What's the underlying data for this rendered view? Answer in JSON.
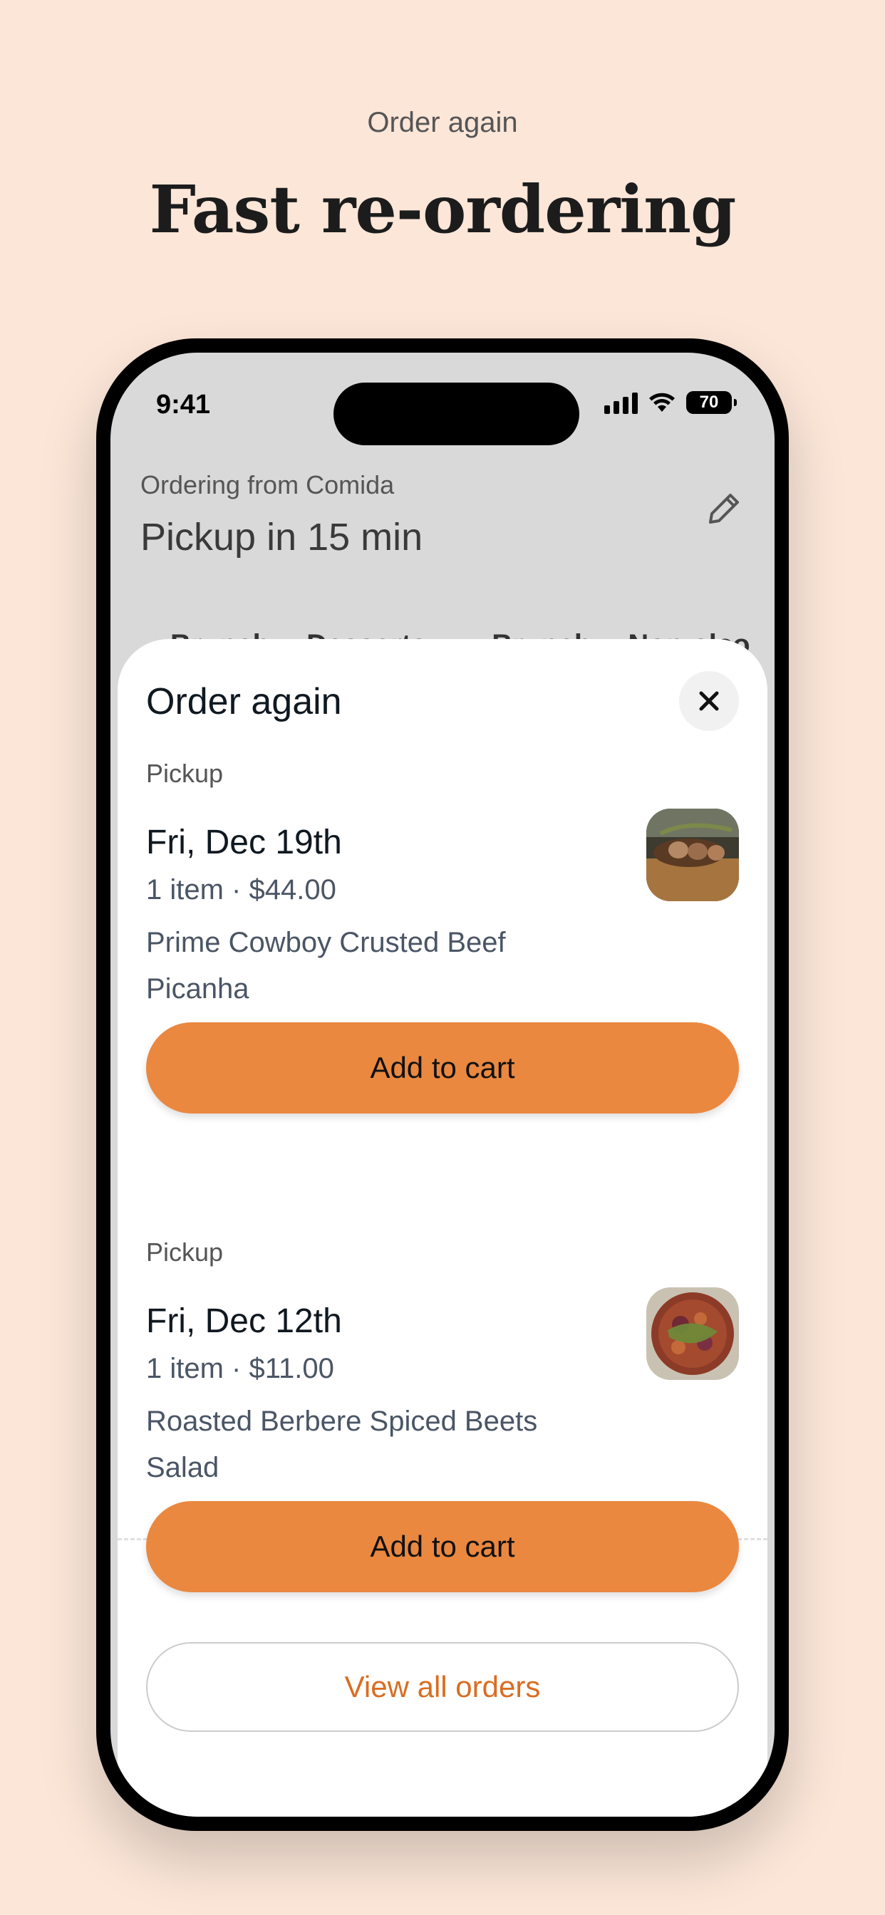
{
  "promo": {
    "eyebrow": "Order again",
    "headline": "Fast re-ordering"
  },
  "status_bar": {
    "time": "9:41",
    "battery": "70"
  },
  "header": {
    "ordering_from": "Ordering from Comida",
    "pickup_time": "Pickup in 15 min",
    "edit_icon": "pencil-icon"
  },
  "categories": [
    "Brunch",
    "Desserts",
    "",
    "Brunch",
    "Non-alco"
  ],
  "sheet": {
    "title": "Order again",
    "close_icon": "close-icon",
    "orders": [
      {
        "type": "Pickup",
        "date": "Fri, Dec 19th",
        "summary": "1 item · $44.00",
        "item": "Prime Cowboy Crusted Beef Picanha",
        "button": "Add to cart"
      },
      {
        "type": "Pickup",
        "date": "Fri, Dec 12th",
        "summary": "1 item · $11.00",
        "item": "Roasted Berbere Spiced Beets Salad",
        "button": "Add to cart"
      }
    ],
    "view_all": "View all orders"
  },
  "colors": {
    "background": "#fbe6d8",
    "accent": "#ea8840",
    "link": "#d96d22"
  }
}
